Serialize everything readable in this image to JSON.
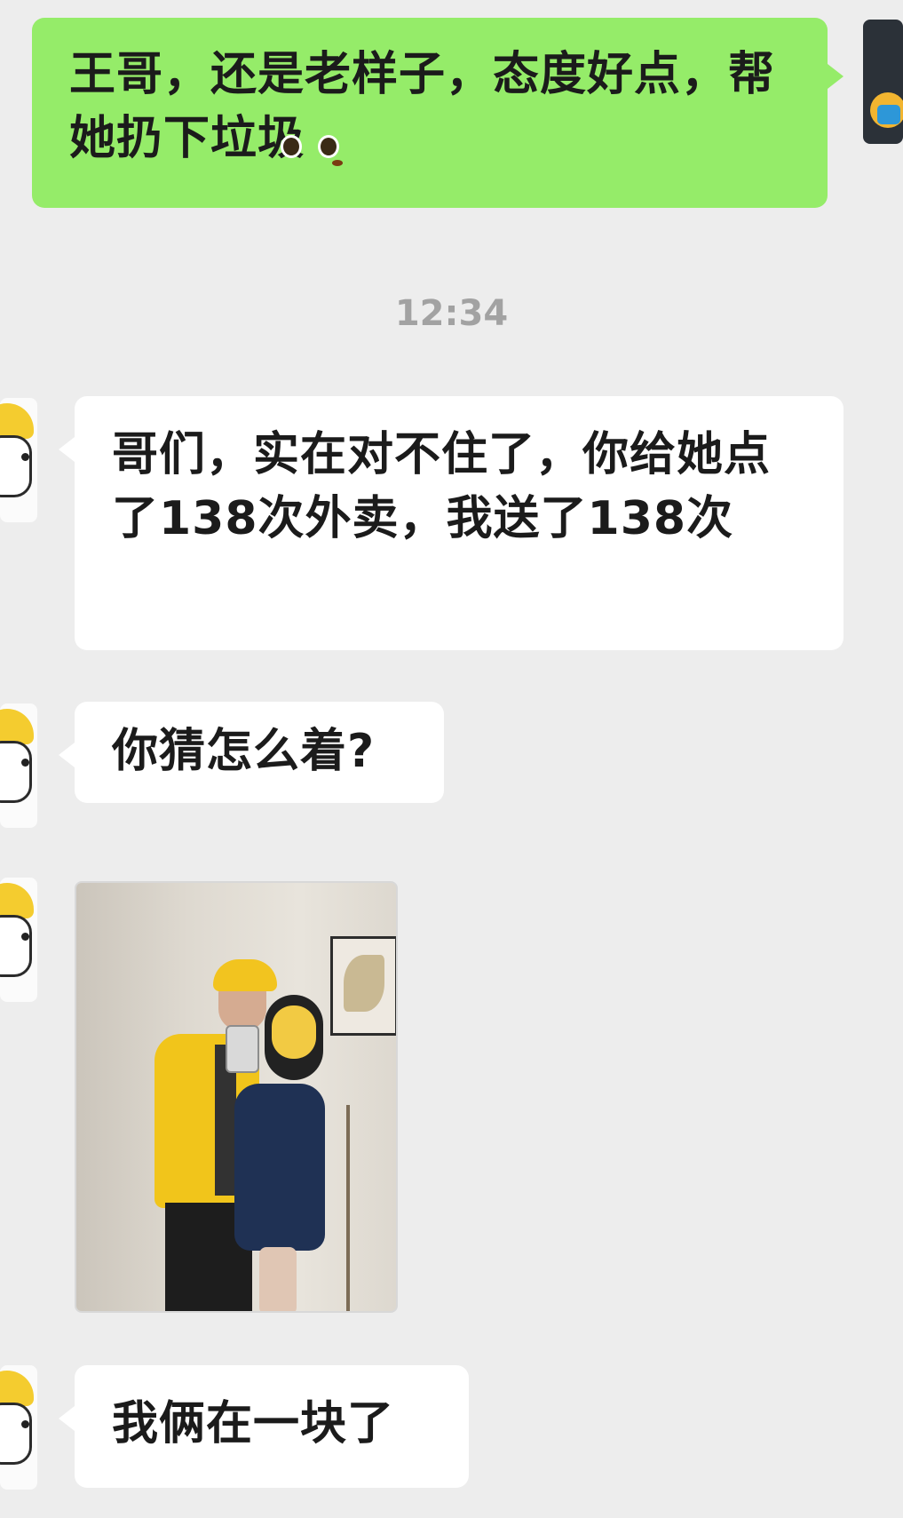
{
  "messages": {
    "outgoing_1": {
      "text": "王哥，还是老样子，态度好点，帮她扔下垃圾",
      "emoji": "pleading-face-emoji"
    },
    "timestamp": "12:34",
    "incoming_1": "哥们，实在对不住了，你给她点了138次外卖，我送了138次",
    "incoming_2": "你猜怎么着?",
    "incoming_3_photo_description": "",
    "incoming_4": "我俩在一块了"
  },
  "colors": {
    "background": "#ededed",
    "outgoing_bubble": "#95ec69",
    "incoming_bubble": "#ffffff",
    "timestamp": "#a2a2a2",
    "rider_yellow": "#f4cc2f"
  }
}
